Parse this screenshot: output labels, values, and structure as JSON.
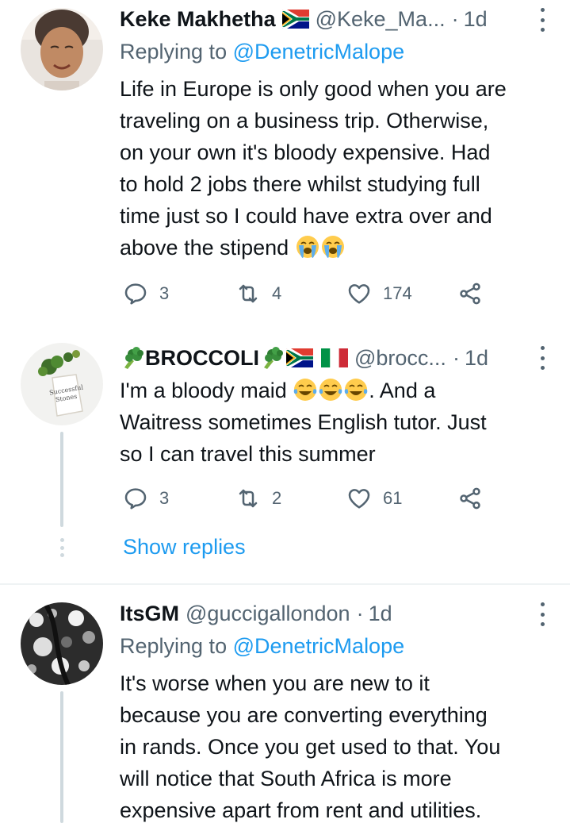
{
  "tweets": [
    {
      "name": "Keke Makhetha",
      "handle": "@Keke_Ma...",
      "time": "1d",
      "replying_label": "Replying to",
      "replying_to": "@DenetricMalope",
      "lines": [
        "Life in Europe is only good when you are",
        "traveling on a business trip. Otherwise,",
        "on your own it's bloody expensive. Had",
        "to hold 2 jobs there whilst studying full",
        "time just so I could have extra over and",
        "above the stipend"
      ],
      "replies": "3",
      "retweets": "4",
      "likes": "174"
    },
    {
      "name": "BROCCOLI",
      "handle": "@brocc...",
      "time": "1d",
      "line1_a": "I'm a bloody maid",
      "line1_b": ". And a",
      "lines": [
        "Waitress sometimes English tutor. Just",
        "so I can travel this summer"
      ],
      "replies": "3",
      "retweets": "2",
      "likes": "61",
      "show_replies": "Show replies"
    },
    {
      "name": "ItsGM",
      "handle": "@guccigallondon",
      "time": "1d",
      "replying_label": "Replying to",
      "replying_to": "@DenetricMalope",
      "lines": [
        "It's worse when you are new to it",
        "because you are converting everything",
        "in rands. Once you get used to that. You",
        "will notice that South Africa is more",
        "expensive apart from rent and utilities."
      ]
    }
  ],
  "colors": {
    "accent": "#1d9bf0",
    "muted": "#536471",
    "text": "#0f1419",
    "line": "#cfd9de"
  },
  "icons": [
    "reply-icon",
    "retweet-icon",
    "like-icon",
    "share-icon",
    "more-icon",
    "south-africa-flag",
    "italy-flag",
    "broccoli-emoji",
    "loudly-crying-emoji",
    "tears-of-joy-emoji"
  ]
}
